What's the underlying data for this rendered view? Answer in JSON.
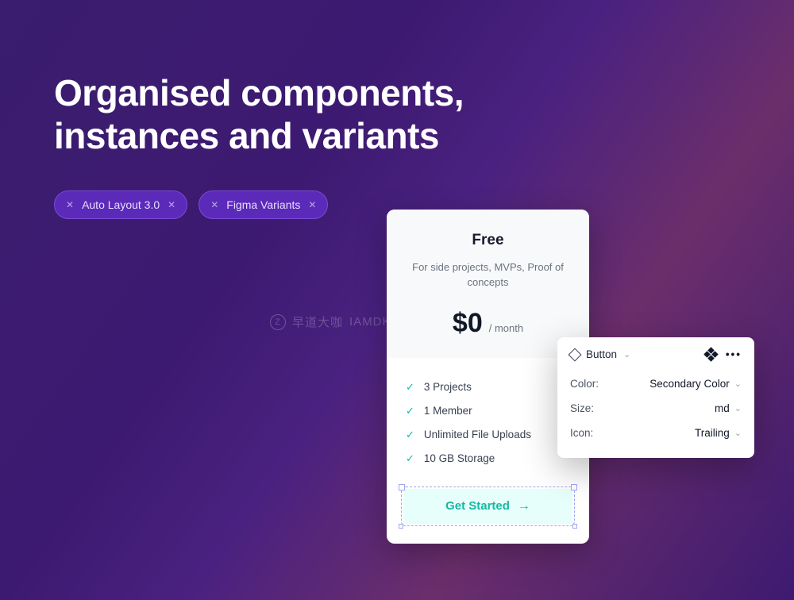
{
  "heading": {
    "line1": "Organised components,",
    "line2": "instances and variants"
  },
  "pills": [
    {
      "label": "Auto Layout 3.0"
    },
    {
      "label": "Figma Variants"
    }
  ],
  "watermark": {
    "badge": "Z",
    "text1": "早道大咖",
    "text2": "IAMDK.TAOBAO.COM"
  },
  "pricing": {
    "plan": "Free",
    "description": "For side projects, MVPs, Proof of concepts",
    "price": "$0",
    "period": "/ month",
    "features": [
      "3 Projects",
      "1 Member",
      "Unlimited File Uploads",
      "10 GB Storage"
    ],
    "cta": "Get Started"
  },
  "inspector": {
    "component": "Button",
    "rows": [
      {
        "label": "Color:",
        "value": "Secondary Color"
      },
      {
        "label": "Size:",
        "value": "md"
      },
      {
        "label": "Icon:",
        "value": "Trailing"
      }
    ]
  }
}
